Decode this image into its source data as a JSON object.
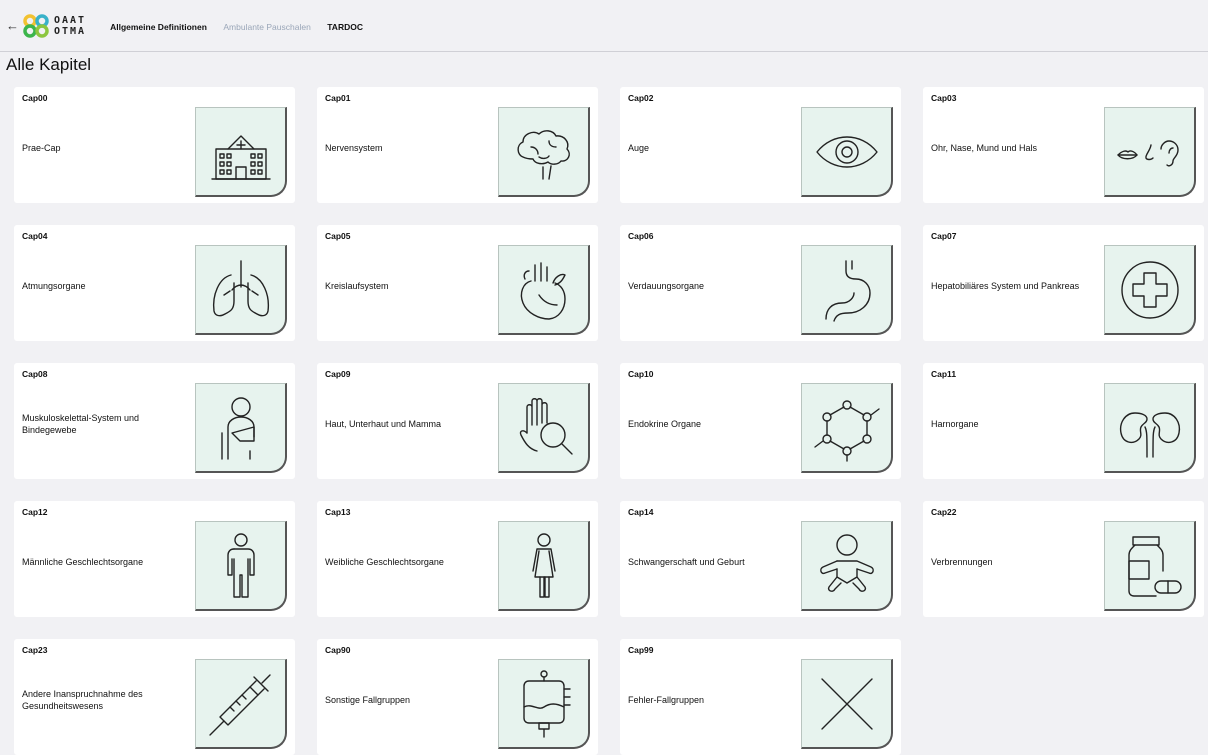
{
  "header": {
    "back_symbol": "←",
    "logo_line1": "OAAT",
    "logo_line2": "OTMA",
    "nav": [
      "Allgemeine Definitionen",
      "Ambulante Pauschalen",
      "TARDOC"
    ]
  },
  "page_title": "Alle Kapitel",
  "colors": {
    "icon_bg": "#e7f3ee",
    "muted_nav": "#9aa6b8"
  },
  "chapters": [
    {
      "code": "Cap00",
      "label": "Prae-Cap",
      "icon": "hospital-icon"
    },
    {
      "code": "Cap01",
      "label": "Nervensystem",
      "icon": "brain-icon"
    },
    {
      "code": "Cap02",
      "label": "Auge",
      "icon": "eye-icon"
    },
    {
      "code": "Cap03",
      "label": "Ohr, Nase, Mund und Hals",
      "icon": "mouth-nose-ear-icon"
    },
    {
      "code": "Cap04",
      "label": "Atmungsorgane",
      "icon": "lungs-icon"
    },
    {
      "code": "Cap05",
      "label": "Kreislaufsystem",
      "icon": "heart-icon"
    },
    {
      "code": "Cap06",
      "label": "Verdauungsorgane",
      "icon": "stomach-icon"
    },
    {
      "code": "Cap07",
      "label": "Hepatobiliäres System und Pankreas",
      "icon": "medical-cross-icon"
    },
    {
      "code": "Cap08",
      "label": "Muskuloskelettal-System und Bindegewebe",
      "icon": "arm-sling-icon"
    },
    {
      "code": "Cap09",
      "label": "Haut, Unterhaut und Mamma",
      "icon": "hand-magnifier-icon"
    },
    {
      "code": "Cap10",
      "label": "Endokrine Organe",
      "icon": "molecule-icon"
    },
    {
      "code": "Cap11",
      "label": "Harnorgane",
      "icon": "kidneys-icon"
    },
    {
      "code": "Cap12",
      "label": "Männliche Geschlechtsorgane",
      "icon": "male-figure-icon"
    },
    {
      "code": "Cap13",
      "label": "Weibliche Geschlechtsorgane",
      "icon": "female-figure-icon"
    },
    {
      "code": "Cap14",
      "label": "Schwangerschaft und Geburt",
      "icon": "baby-icon"
    },
    {
      "code": "Cap22",
      "label": "Verbrennungen",
      "icon": "medicine-bottle-icon"
    },
    {
      "code": "Cap23",
      "label": "Andere Inanspruchnahme des Gesundheitswesens",
      "icon": "syringe-icon"
    },
    {
      "code": "Cap90",
      "label": "Sonstige Fallgruppen",
      "icon": "iv-bag-icon"
    },
    {
      "code": "Cap99",
      "label": "Fehler-Fallgruppen",
      "icon": "x-icon"
    }
  ]
}
